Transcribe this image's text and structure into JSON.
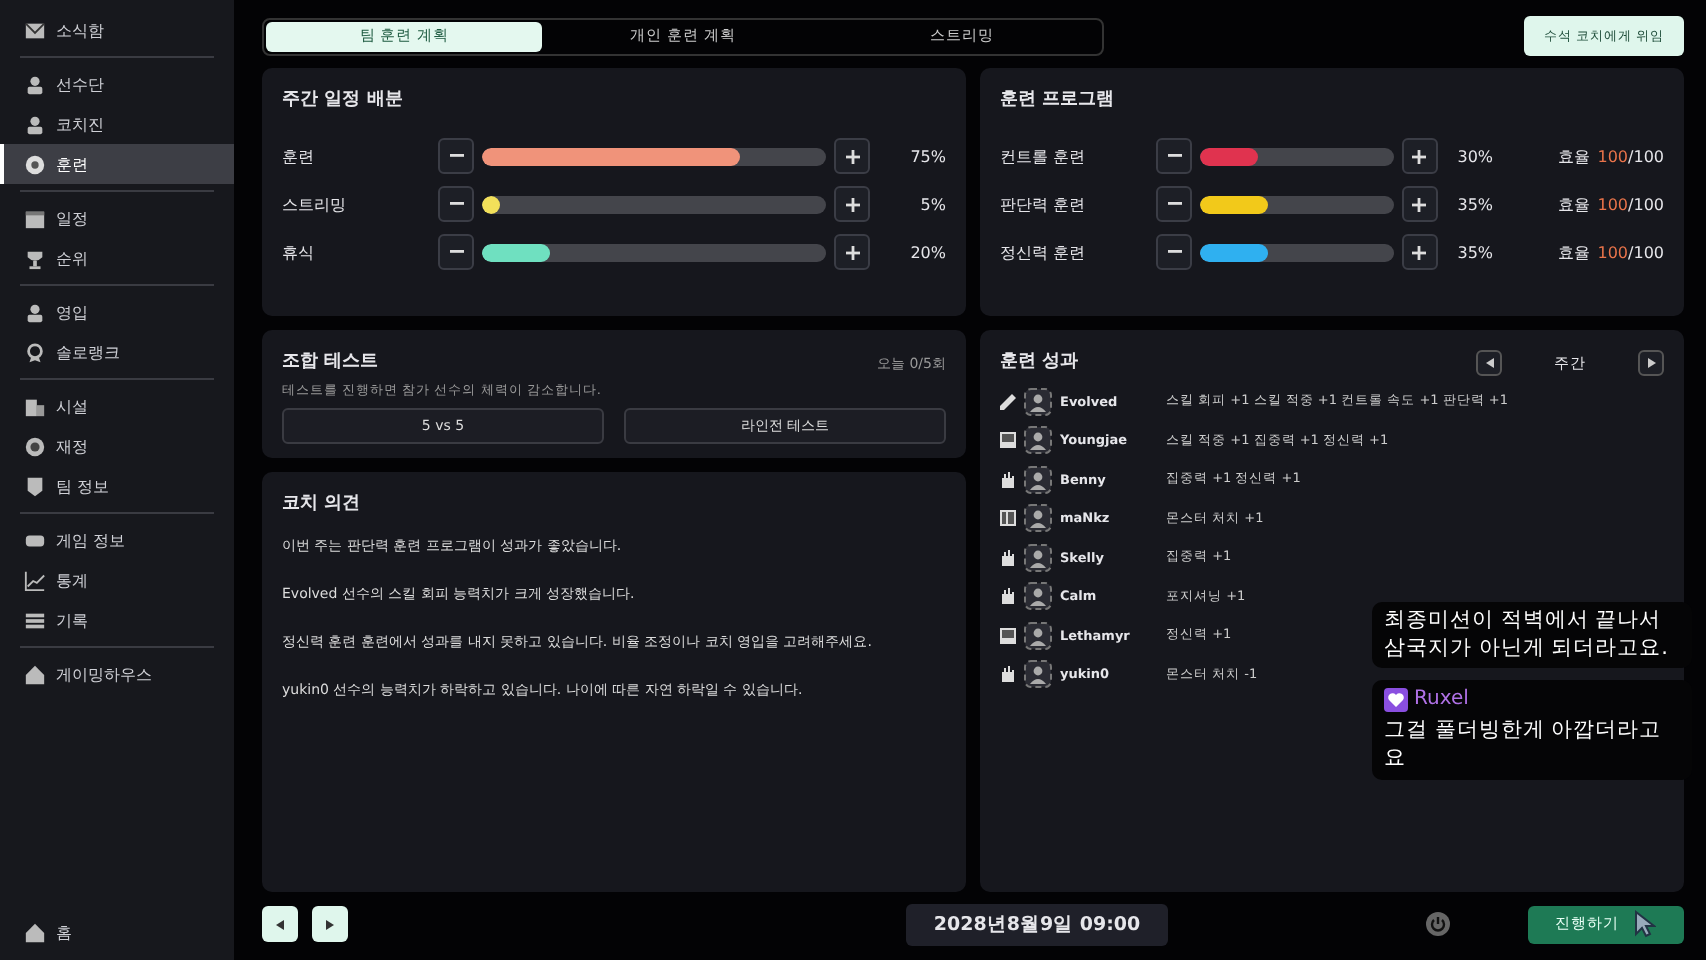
{
  "sidebar": {
    "groups": [
      [
        {
          "label": "소식함",
          "selected": false
        }
      ],
      [
        {
          "label": "선수단",
          "selected": false
        },
        {
          "label": "코치진",
          "selected": false
        },
        {
          "label": "훈련",
          "selected": true
        }
      ],
      [
        {
          "label": "일정",
          "selected": false
        },
        {
          "label": "순위",
          "selected": false
        }
      ],
      [
        {
          "label": "영입",
          "selected": false
        },
        {
          "label": "솔로랭크",
          "selected": false
        }
      ],
      [
        {
          "label": "시설",
          "selected": false
        },
        {
          "label": "재정",
          "selected": false
        },
        {
          "label": "팀 정보",
          "selected": false
        }
      ],
      [
        {
          "label": "게임 정보",
          "selected": false
        },
        {
          "label": "통계",
          "selected": false
        },
        {
          "label": "기록",
          "selected": false
        }
      ],
      [
        {
          "label": "게이밍하우스",
          "selected": false
        }
      ]
    ],
    "home": "홈"
  },
  "tabs": [
    {
      "label": "팀 훈련 계획",
      "selected": true
    },
    {
      "label": "개인 훈련 계획",
      "selected": false
    },
    {
      "label": "스트리밍",
      "selected": false
    }
  ],
  "delegate_button": "수석 코치에게 위임",
  "schedule": {
    "title": "주간 일정 배분",
    "rows": [
      {
        "label": "훈련",
        "level": 0.75,
        "reading": "75%",
        "color": "#f0937a"
      },
      {
        "label": "스트리밍",
        "level": 0.05,
        "reading": "5%",
        "color": "#f2e05a"
      },
      {
        "label": "휴식",
        "level": 0.2,
        "reading": "20%",
        "color": "#6fe0c0"
      }
    ]
  },
  "program": {
    "title": "훈련 프로그램",
    "rows": [
      {
        "label": "컨트롤 훈련",
        "level": 0.3,
        "reading": "30%",
        "color": "#e0334f",
        "efficiency_label": "효율",
        "efficiency_value": "100",
        "efficiency_max": "/100"
      },
      {
        "label": "판단력 훈련",
        "level": 0.35,
        "reading": "35%",
        "color": "#f2c91a",
        "efficiency_label": "효율",
        "efficiency_value": "100",
        "efficiency_max": "/100"
      },
      {
        "label": "정신력 훈련",
        "level": 0.35,
        "reading": "35%",
        "color": "#2fb0f0",
        "efficiency_label": "효율",
        "efficiency_value": "100",
        "efficiency_max": "/100"
      }
    ]
  },
  "combo_test": {
    "title": "조합 테스트",
    "count": "오늘 0/5회",
    "description": "테스트를 진행하면 참가 선수의 체력이 감소합니다.",
    "buttons": [
      "5 vs 5",
      "라인전 테스트"
    ]
  },
  "results": {
    "title": "훈련 성과",
    "period": "주간",
    "rows": [
      {
        "name": "Evolved",
        "gains": "스킬 회피 +1  스킬 적중 +1  컨트롤 속도 +1  판단력 +1"
      },
      {
        "name": "Youngjae",
        "gains": "스킬 적중 +1  집중력 +1  정신력 +1"
      },
      {
        "name": "Benny",
        "gains": "집중력 +1  정신력 +1"
      },
      {
        "name": "maNkz",
        "gains": "몬스터 처치 +1"
      },
      {
        "name": "Skelly",
        "gains": "집중력 +1"
      },
      {
        "name": "Calm",
        "gains": "포지셔닝 +1"
      },
      {
        "name": "Lethamyr",
        "gains": "정신력 +1"
      },
      {
        "name": "yukin0",
        "gains": "몬스터 처치 -1"
      }
    ]
  },
  "coach": {
    "title": "코치 의견",
    "notes": [
      "이번 주는 판단력 훈련 프로그램이 성과가 좋았습니다.",
      "Evolved 선수의 스킬 회피 능력치가 크게 성장했습니다.",
      "정신력 훈련 훈련에서 성과를 내지 못하고 있습니다. 비율 조정이나 코치 영입을 고려해주세요.",
      "yukin0 선수의 능력치가 하락하고 있습니다. 나이에 따른 자연 하락일 수 있습니다."
    ]
  },
  "footer": {
    "date": "2028년8월9일 09:00",
    "proceed_button": "진행하기"
  },
  "chat": [
    {
      "text": "최종미션이 적벽에서 끝나서 삼국지가 아닌게 되더라고요."
    },
    {
      "user": "Ruxel",
      "text": "그걸 풀더빙한게 아깝더라고요"
    }
  ]
}
